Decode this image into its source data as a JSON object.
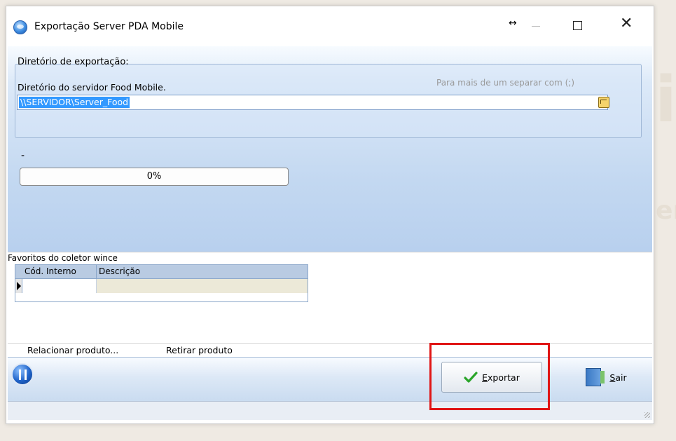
{
  "window": {
    "title": "Exportação Server PDA Mobile",
    "resize_glyph": "↔",
    "close_glyph": "✕"
  },
  "export": {
    "group_title": "Diretório de exportação:",
    "dir_label": "Diretório do servidor Food Mobile.",
    "hint": "Para mais de um separar com (;)",
    "dir_value": "\\\\SERVIDOR\\Server_Food"
  },
  "progress": {
    "status_text": "-",
    "percent_value": 0,
    "percent_label": "0%",
    "fill_color": "#2fa84f"
  },
  "favorites": {
    "label": "Favoritos do coletor wince",
    "columns": [
      "Cód. Interno",
      "Descrição"
    ]
  },
  "actions": {
    "relate_product": "Relacionar produto...",
    "remove_product": "Retirar produto"
  },
  "footer": {
    "logo_icon": "cutlery-icon",
    "export_mnemonic": "E",
    "export_rest": "xportar",
    "exit_mnemonic": "S",
    "exit_rest": "air"
  },
  "colors": {
    "highlight": "#e01515",
    "selection": "#3399ff",
    "check": "#2aa52a"
  }
}
